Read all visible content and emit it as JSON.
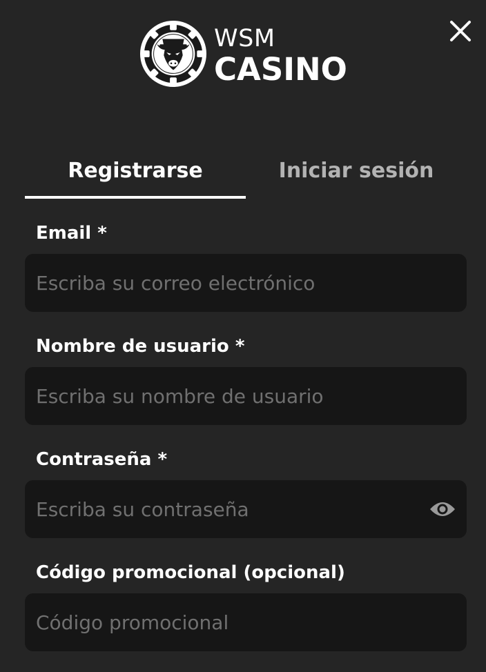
{
  "brand": {
    "line1": "WSM",
    "line2": "CASINO",
    "logo_icon": "poker-chip-bull-icon"
  },
  "close_icon": "close-icon",
  "tabs": [
    {
      "label": "Registrarse",
      "active": true
    },
    {
      "label": "Iniciar sesión",
      "active": false
    }
  ],
  "form": {
    "email": {
      "label": "Email *",
      "placeholder": "Escriba su correo electrónico",
      "value": ""
    },
    "username": {
      "label": "Nombre de usuario *",
      "placeholder": "Escriba su nombre de usuario",
      "value": ""
    },
    "password": {
      "label": "Contraseña *",
      "placeholder": "Escriba su contraseña",
      "value": "",
      "toggle_icon": "eye-icon"
    },
    "promo": {
      "label": "Código promocional (opcional)",
      "placeholder": "Código promocional",
      "value": ""
    }
  },
  "colors": {
    "background": "#252525",
    "field_background": "#161616",
    "text": "#ffffff",
    "inactive_tab": "#b3b3b3",
    "placeholder": "#707070"
  }
}
